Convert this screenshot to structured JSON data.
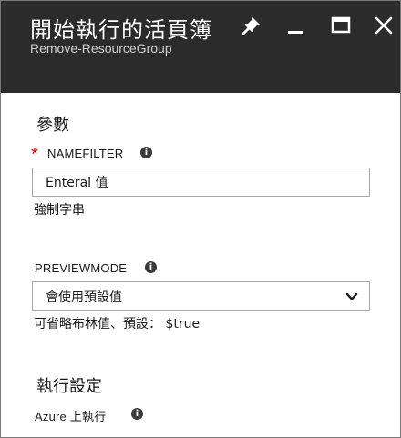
{
  "header": {
    "title": "開始執行的活頁簿",
    "subtitle": "Remove-ResourceGroup"
  },
  "parameters": {
    "section_title": "參數",
    "namefilter": {
      "required_mark": "*",
      "label": "NAMEFILTER",
      "value": "Enteral 值",
      "helper": "強制字串"
    },
    "previewmode": {
      "label": "PREVIEWMODE",
      "selected": "會使用預設值",
      "helper": "可省略布林值、預設： $true"
    }
  },
  "run_settings": {
    "section_title": "執行設定",
    "run_on_label": "Azure 上執行"
  },
  "icons": {
    "info": "i"
  }
}
